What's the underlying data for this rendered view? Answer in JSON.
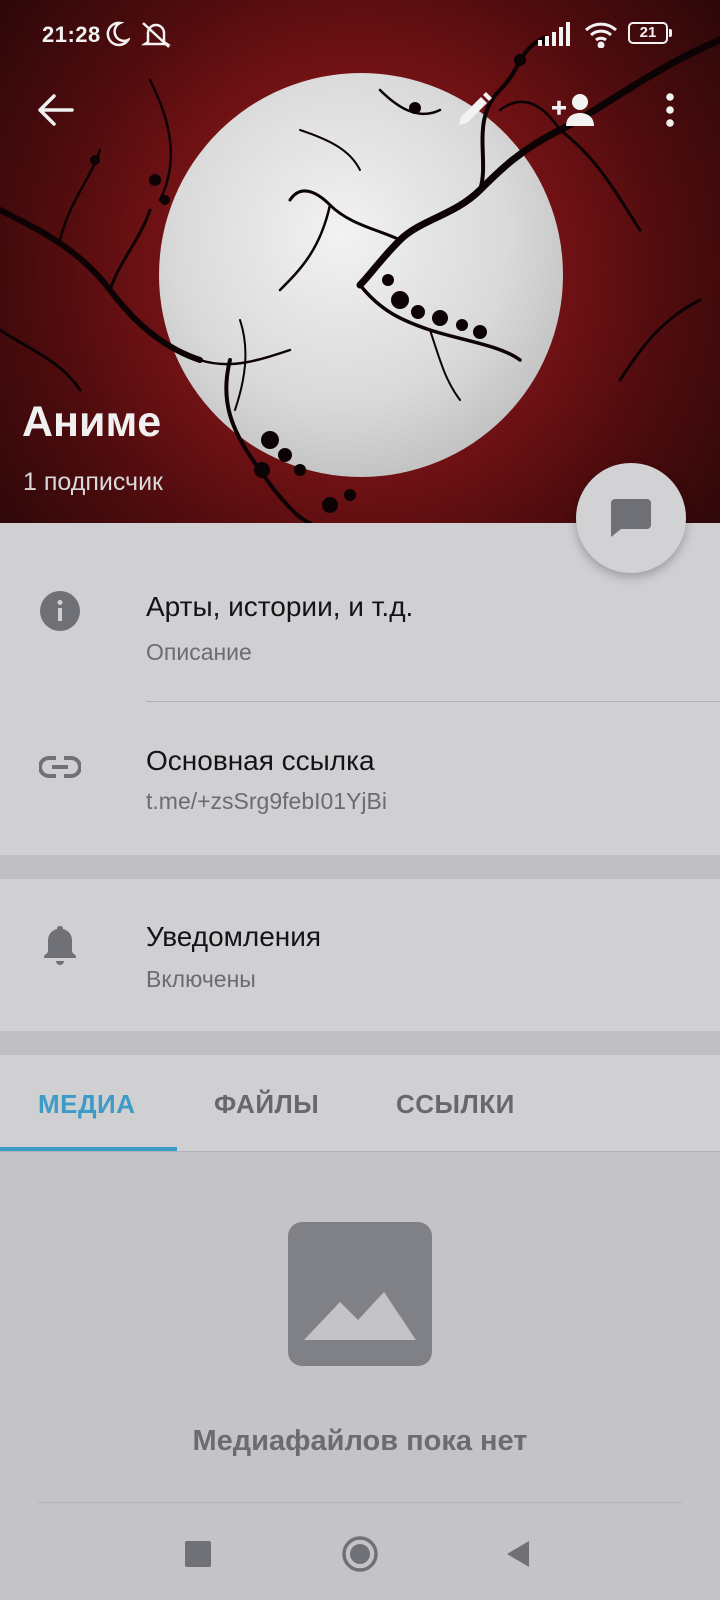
{
  "status_bar": {
    "time": "21:28",
    "battery_level": "21",
    "icons": [
      "moon-icon",
      "bell-off-icon",
      "signal-icon",
      "wifi-icon",
      "battery-icon"
    ]
  },
  "top_bar": {
    "icons": [
      "back-arrow-icon",
      "pencil-icon",
      "add-person-icon",
      "more-vertical-icon"
    ]
  },
  "channel": {
    "title": "Аниме",
    "subscribers": "1 подписчик"
  },
  "fab": {
    "icon": "chat-bubble-icon"
  },
  "info": {
    "description": {
      "value": "Арты, истории, и т.д.",
      "label": "Описание",
      "icon": "info-icon"
    },
    "link": {
      "title": "Основная ссылка",
      "value": "t.me/+zsSrg9febI01YjBi",
      "icon": "link-icon"
    },
    "notifications": {
      "title": "Уведомления",
      "value": "Включены",
      "icon": "bell-icon"
    }
  },
  "tabs": [
    {
      "label": "МЕДИА",
      "active": true
    },
    {
      "label": "ФАЙЛЫ",
      "active": false
    },
    {
      "label": "ССЫЛКИ",
      "active": false
    }
  ],
  "empty_state": {
    "icon": "image-placeholder-icon",
    "text": "Медиафайлов пока нет"
  },
  "nav_bar": {
    "icons": [
      "recents-square-icon",
      "home-circle-icon",
      "back-triangle-icon"
    ]
  },
  "colors": {
    "accent": "#3d9bc8",
    "header_red": "#8a1a1c",
    "background": "#c4c4c7"
  }
}
